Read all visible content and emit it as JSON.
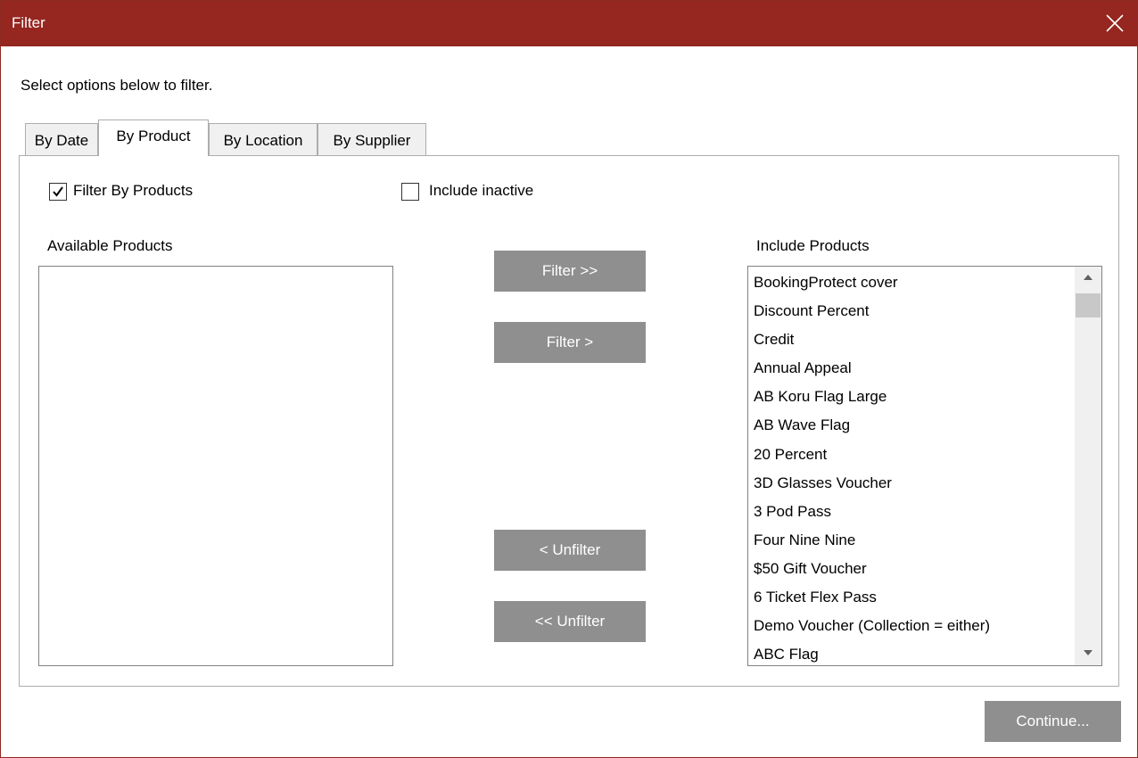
{
  "window": {
    "title": "Filter"
  },
  "intro": "Select options below to filter.",
  "tabs": [
    {
      "label": "By Date",
      "active": false
    },
    {
      "label": "By Product",
      "active": true
    },
    {
      "label": "By Location",
      "active": false
    },
    {
      "label": "By Supplier",
      "active": false
    }
  ],
  "options": {
    "filter_by_products": {
      "label": "Filter By Products",
      "checked": true
    },
    "include_inactive": {
      "label": "Include inactive",
      "checked": false
    }
  },
  "available": {
    "label": "Available Products",
    "items": []
  },
  "included": {
    "label": "Include Products",
    "items": [
      "BookingProtect cover",
      "Discount Percent",
      "Credit",
      "Annual Appeal",
      "AB Koru Flag Large",
      "AB Wave Flag",
      "20 Percent",
      "3D Glasses Voucher",
      "3 Pod Pass",
      "Four Nine Nine",
      "$50 Gift Voucher",
      "6 Ticket Flex Pass",
      "Demo Voucher (Collection = either)",
      "ABC Flag"
    ]
  },
  "buttons": {
    "filter_all": "Filter >>",
    "filter": "Filter >",
    "unfilter": "< Unfilter",
    "unfilter_all": "<< Unfilter",
    "continue": "Continue..."
  },
  "colors": {
    "titlebar": "#952620",
    "button": "#8f8f8f"
  }
}
